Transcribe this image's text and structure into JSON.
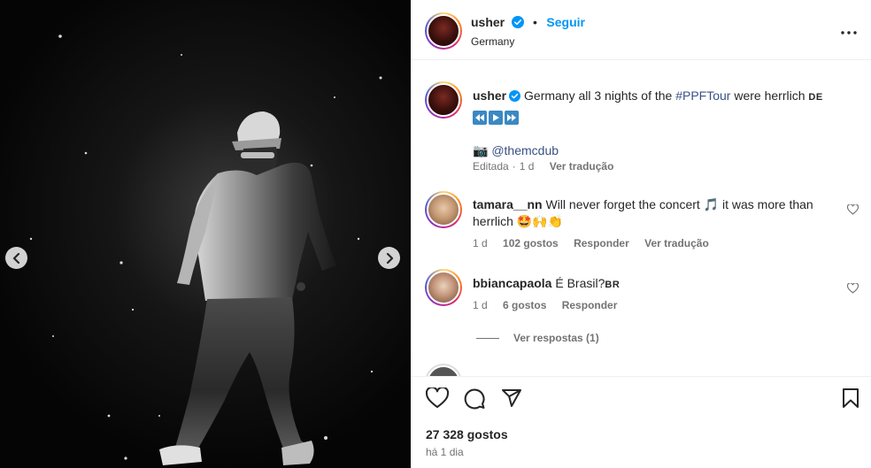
{
  "post": {
    "username": "usher",
    "follow_label": "Seguir",
    "dot": "•",
    "location": "Germany",
    "more_icon": "more-options-icon"
  },
  "caption": {
    "username": "usher",
    "text_before": "Germany all 3 nights of the ",
    "hashtag": "#PPFTour",
    "text_after": " were herrlich",
    "flag": "DE",
    "credit_emoji": "📷",
    "credit_mention": "@themcdub",
    "meta_edited": "Editada",
    "meta_dot": "·",
    "meta_time": "1 d",
    "meta_translate": "Ver tradução"
  },
  "comments": [
    {
      "username": "tamara__nn",
      "text": "Will never forget the concert 🎵 it was more than herrlich 🤩🙌👏",
      "time": "1 d",
      "likes": "102 gostos",
      "reply": "Responder",
      "translate": "Ver tradução"
    },
    {
      "username": "bbiancapaola",
      "text": "É Brasil?",
      "flag": "BR",
      "time": "1 d",
      "likes": "6 gostos",
      "reply": "Responder",
      "view_replies": "Ver respostas (1)"
    }
  ],
  "actions": {
    "likes_count": "27 328 gostos",
    "time_ago": "há 1 dia"
  },
  "colors": {
    "accent": "#0095f6",
    "link": "#385185",
    "text": "#262626",
    "muted": "#737373"
  }
}
